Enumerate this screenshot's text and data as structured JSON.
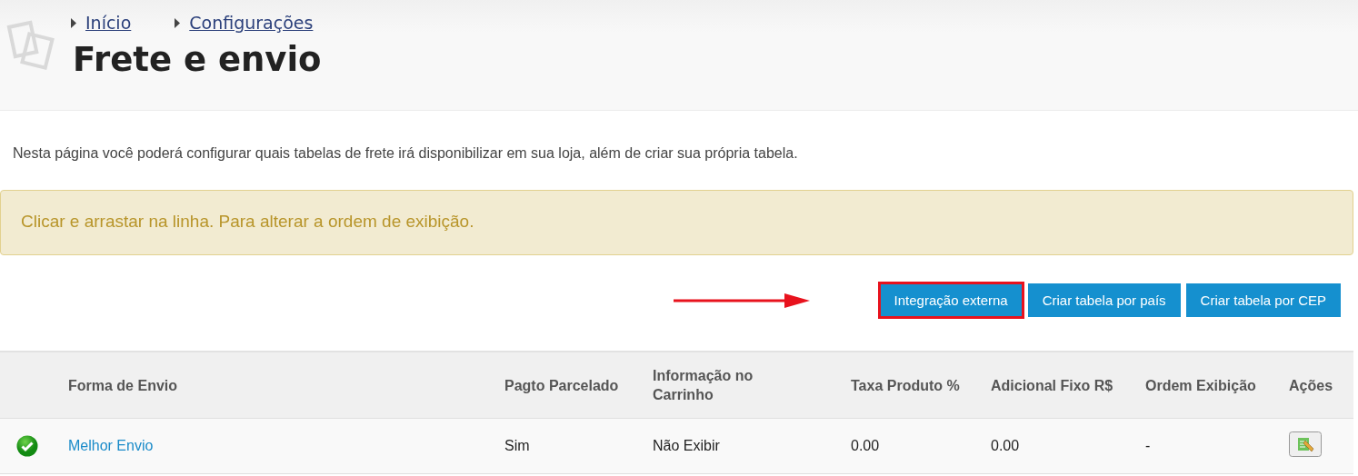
{
  "breadcrumbs": [
    "Início",
    "Configurações"
  ],
  "title": "Frete e envio",
  "description": "Nesta página você poderá configurar quais tabelas de frete irá disponibilizar em sua loja, além de criar sua própria tabela.",
  "alert": "Clicar e arrastar na linha. Para alterar a ordem de exibição.",
  "buttons": [
    {
      "label": "Integração externa",
      "highlighted": true
    },
    {
      "label": "Criar tabela por país",
      "highlighted": false
    },
    {
      "label": "Criar tabela por CEP",
      "highlighted": false
    }
  ],
  "table": {
    "columns": [
      "",
      "Forma de Envio",
      "Pagto Parcelado",
      "Informação no Carrinho",
      "Taxa Produto %",
      "Adicional Fixo R$",
      "Ordem Exibição",
      "Ações"
    ],
    "rows": [
      {
        "active": true,
        "name": "Melhor Envio",
        "installments": "Sim",
        "cart_info": "Não Exibir",
        "product_fee": "0.00",
        "fixed_fee": "0.00",
        "order": "-"
      }
    ]
  }
}
